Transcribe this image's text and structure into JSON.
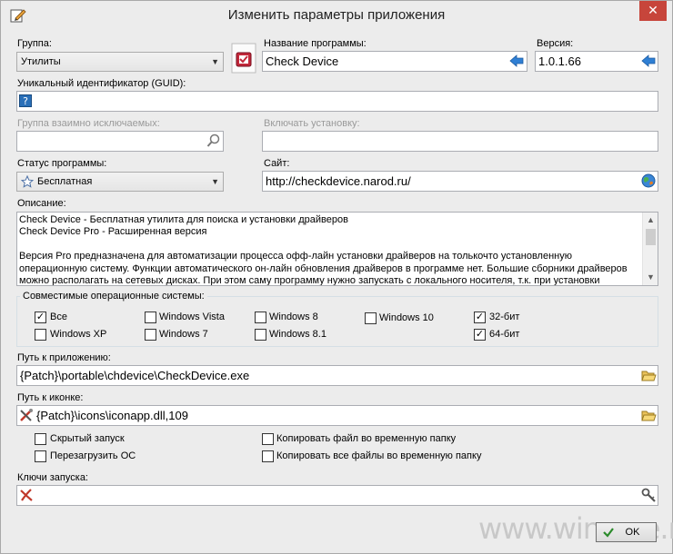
{
  "window": {
    "title": "Изменить параметры приложения",
    "close_glyph": "✕"
  },
  "group": {
    "label": "Группа:",
    "value": "Утилиты"
  },
  "program_name": {
    "label": "Название программы:",
    "value": "Check Device"
  },
  "version": {
    "label": "Версия:",
    "value": "1.0.1.66"
  },
  "guid": {
    "label": "Уникальный идентификатор (GUID):",
    "value": ""
  },
  "exclusive_group": {
    "label": "Группа взаимно исключаемых:",
    "value": ""
  },
  "include_install": {
    "label": "Включать установку:",
    "value": ""
  },
  "status": {
    "label": "Статус программы:",
    "value": "Бесплатная"
  },
  "site": {
    "label": "Сайт:",
    "value": "http://checkdevice.narod.ru/"
  },
  "description": {
    "label": "Описание:",
    "text": "Check Device - Бесплатная утилита для поиска и установки драйверов\nCheck Device Pro - Расширенная версия\n\nВерсия Pro предназначена для автоматизации процесса офф-лайн установки драйверов на толькочто установленную\nоперационную систему. Функции автоматического он-лайн обновления драйверов в программе нет. Большие сборники драйверов\nможно располагать на сетевых дисках. При этом саму программу нужно запускать с локального носителя, т.к. при установки"
  },
  "os": {
    "title": "Совместимые операционные системы:",
    "items": [
      {
        "label": "Все",
        "checked": true
      },
      {
        "label": "Windows Vista",
        "checked": false
      },
      {
        "label": "Windows 8",
        "checked": false
      },
      {
        "label": "Windows 10",
        "checked": false
      },
      {
        "label": "32-бит",
        "checked": true
      },
      {
        "label": "Windows XP",
        "checked": false
      },
      {
        "label": "Windows 7",
        "checked": false
      },
      {
        "label": "Windows 8.1",
        "checked": false
      },
      {
        "label": "64-бит",
        "checked": true
      }
    ]
  },
  "app_path": {
    "label": "Путь к приложению:",
    "value": "{Patch}\\portable\\chdevice\\CheckDevice.exe"
  },
  "icon_path": {
    "label": "Путь к иконке:",
    "value": "{Patch}\\icons\\iconapp.dll,109"
  },
  "options": [
    {
      "label": "Скрытый запуск",
      "checked": false
    },
    {
      "label": "Копировать файл во временную папку",
      "checked": false
    },
    {
      "label": "Перезагрузить ОС",
      "checked": false
    },
    {
      "label": "Копировать все файлы во временную папку",
      "checked": false
    }
  ],
  "launch_keys": {
    "label": "Ключи запуска:",
    "value": ""
  },
  "watermark": "www.wincore.ru",
  "ok_button": "OK"
}
